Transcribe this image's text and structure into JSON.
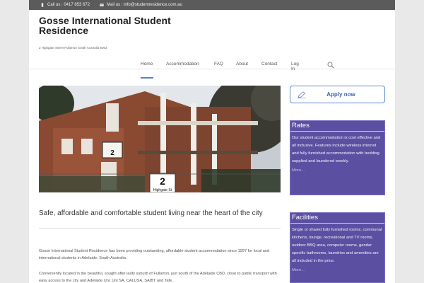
{
  "topbar": {
    "call": "Call us : 0417 853 672",
    "mail": "Mail us : info@studentresidence.com.au"
  },
  "site": {
    "title": "Gosse International Student Residence",
    "tagline": "2 Highgate Street Fullarton South Australia 5063"
  },
  "nav": {
    "items": [
      "Home",
      "Accommodation",
      "FAQ",
      "About",
      "Contact",
      "Log In"
    ]
  },
  "hero": {
    "sign_number": "2",
    "sign_street": "Highgate St",
    "plaque_number": "2"
  },
  "intro": {
    "title": "Safe, affordable and comfortable student living near the heart of the city",
    "p1": "Gosse International Student Residence has been providing outstanding, affordable student accommodation since 1997 for local and international students  in Adelaide, South Australia.",
    "p2": "Conveniently located in the beautiful, sought after leafy suburb of Fullarton, just south of the Adelaide CBD, close to public transport with easy access to the city and Adelaide Uni, Uni SA, CALUSA, SAIBT  and Tafe."
  },
  "sidebar": {
    "apply_label": "Apply now",
    "rates": {
      "heading": "Rates",
      "text": "Our student accommodation is cost effective and all inclusive. Features include wireless internet and fully furnished accommodation with bedding supplied and laundered weekly.",
      "more": "More..."
    },
    "facilities": {
      "heading": "Facilities",
      "text": "Single or shared fully furnished rooms, communal kitchens, lounge, recreational and TV rooms, outdoor BBQ area, computer rooms, gender specific bathrooms, laundries and amenities are all included in the price.",
      "more": "More..."
    }
  },
  "colors": {
    "topbar": "#5b5b5b",
    "accent": "#5a7fd3",
    "box": "#5b4fa2"
  }
}
